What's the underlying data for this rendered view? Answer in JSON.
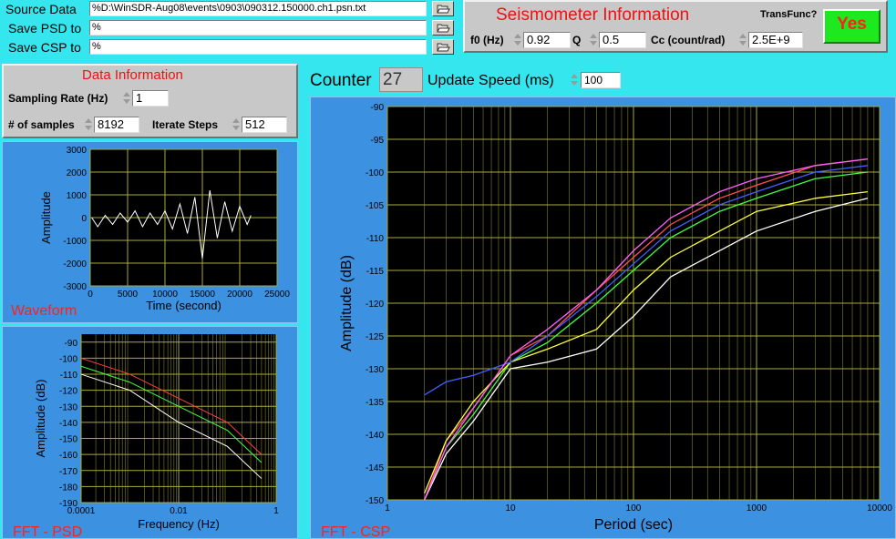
{
  "files": {
    "source_label": "Source Data",
    "source_value": "D:\\WinSDR-Aug08\\events\\0903\\090312.150000.ch1.psn.txt",
    "psd_label": "Save PSD to",
    "psd_value": "",
    "csp_label": "Save CSP to",
    "csp_value": "",
    "path_prefix": "%",
    "browse_icon": "folder-open-icon"
  },
  "seismometer": {
    "title": "Seismometer Information",
    "f0_label": "f0 (Hz)",
    "f0_value": "0.92",
    "q_label": "Q",
    "q_value": "0.5",
    "cc_label": "Cc (count/rad)",
    "cc_value": "2.5E+9",
    "transfunc_label": "TransFunc?",
    "transfunc_value": "Yes",
    "transfunc_color": "#1ee81e"
  },
  "data_info": {
    "title": "Data Information",
    "rate_label": "Sampling Rate (Hz)",
    "rate_value": "1",
    "samples_label": "# of samples",
    "samples_value": "8192",
    "iterate_label": "Iterate Steps",
    "iterate_value": "512"
  },
  "counter": {
    "label": "Counter",
    "value": "27",
    "speed_label": "Update Speed (ms)",
    "speed_value": "100"
  },
  "chart_data": [
    {
      "name": "Waveform",
      "type": "line",
      "xlabel": "Time (second)",
      "ylabel": "Amplitude",
      "xlim": [
        0,
        25000
      ],
      "ylim": [
        -3000,
        3000
      ],
      "xticks": [
        "0",
        "5000",
        "10000",
        "15000",
        "20000",
        "25000"
      ],
      "yticks": [
        "3000",
        "2000",
        "1000",
        "0",
        "-1000",
        "-2000",
        "-3000"
      ],
      "grid": true,
      "series": [
        {
          "color": "#ffffff",
          "x": [
            200,
            1000,
            2000,
            3000,
            4000,
            5000,
            6000,
            7000,
            8000,
            9000,
            10000,
            11000,
            12000,
            13000,
            14000,
            15000,
            16000,
            17000,
            18000,
            19000,
            20000,
            21000,
            21500
          ],
          "y": [
            0,
            -400,
            100,
            -300,
            200,
            -200,
            300,
            -400,
            200,
            -300,
            300,
            -500,
            600,
            -700,
            900,
            -1800,
            1200,
            -900,
            700,
            -600,
            500,
            -300,
            100
          ]
        }
      ]
    },
    {
      "name": "FFT - PSD",
      "type": "line",
      "xlabel": "Frequency (Hz)",
      "ylabel": "Amplitude (dB)",
      "xscale": "log",
      "xlim": [
        0.0001,
        1
      ],
      "ylim": [
        -190,
        -85
      ],
      "xticks": [
        "0.0001",
        "0.01",
        "1"
      ],
      "yticks": [
        "-90",
        "-100",
        "-110",
        "-120",
        "-130",
        "-140",
        "-150",
        "-160",
        "-170",
        "-180",
        "-190"
      ],
      "grid": true,
      "series": [
        {
          "color": "#ff4040",
          "x": [
            0.0001,
            0.001,
            0.01,
            0.1,
            0.5
          ],
          "y": [
            -100,
            -110,
            -125,
            -140,
            -160
          ]
        },
        {
          "color": "#40ff40",
          "x": [
            0.0001,
            0.001,
            0.01,
            0.1,
            0.5
          ],
          "y": [
            -105,
            -115,
            -130,
            -145,
            -165
          ]
        },
        {
          "color": "#ffffff",
          "x": [
            0.0001,
            0.001,
            0.01,
            0.1,
            0.5
          ],
          "y": [
            -110,
            -120,
            -140,
            -155,
            -175
          ]
        }
      ]
    },
    {
      "name": "FFT - CSP",
      "type": "line",
      "xlabel": "Period (sec)",
      "ylabel": "Amplitude (dB)",
      "xscale": "log",
      "xlim": [
        1,
        10000
      ],
      "ylim": [
        -150,
        -90
      ],
      "xticks": [
        "1",
        "10",
        "100",
        "1000",
        "10000"
      ],
      "yticks": [
        "-90",
        "-95",
        "-100",
        "-105",
        "-110",
        "-115",
        "-120",
        "-125",
        "-130",
        "-135",
        "-140",
        "-145",
        "-150"
      ],
      "grid": true,
      "series": [
        {
          "color": "#ff5050",
          "x": [
            2,
            3,
            5,
            10,
            20,
            50,
            100,
            200,
            500,
            1000,
            3000,
            8000
          ],
          "y": [
            -150,
            -141,
            -136,
            -128,
            -125,
            -118,
            -113,
            -108,
            -104,
            -102,
            -99,
            -98
          ]
        },
        {
          "color": "#40ff40",
          "x": [
            2,
            3,
            5,
            10,
            20,
            50,
            100,
            200,
            500,
            1000,
            3000,
            8000
          ],
          "y": [
            -150,
            -142,
            -137,
            -129,
            -126,
            -120,
            -115,
            -110,
            -106,
            -104,
            -101,
            -100
          ]
        },
        {
          "color": "#ffffff",
          "x": [
            2,
            3,
            5,
            10,
            20,
            50,
            100,
            200,
            500,
            1000,
            3000,
            8000
          ],
          "y": [
            -150,
            -143,
            -138,
            -130,
            -129,
            -127,
            -122,
            -116,
            -112,
            -109,
            -106,
            -104
          ]
        },
        {
          "color": "#ffff40",
          "x": [
            2,
            3,
            5,
            10,
            20,
            50,
            100,
            200,
            500,
            1000,
            3000,
            8000
          ],
          "y": [
            -149,
            -141,
            -135,
            -129,
            -127,
            -124,
            -118,
            -113,
            -109,
            -106,
            -104,
            -103
          ]
        },
        {
          "color": "#4060ff",
          "x": [
            2,
            3,
            5,
            10,
            20,
            50,
            100,
            200,
            500,
            1000,
            3000,
            8000
          ],
          "y": [
            -134,
            -132,
            -131,
            -129,
            -125,
            -119,
            -114,
            -109,
            -105,
            -103,
            -100,
            -99
          ]
        },
        {
          "color": "#ff60ff",
          "x": [
            2,
            3,
            5,
            10,
            20,
            50,
            100,
            200,
            500,
            1000,
            3000,
            8000
          ],
          "y": [
            -150,
            -142,
            -136,
            -128,
            -124,
            -118,
            -112,
            -107,
            -103,
            -101,
            -99,
            -98
          ]
        }
      ]
    }
  ]
}
